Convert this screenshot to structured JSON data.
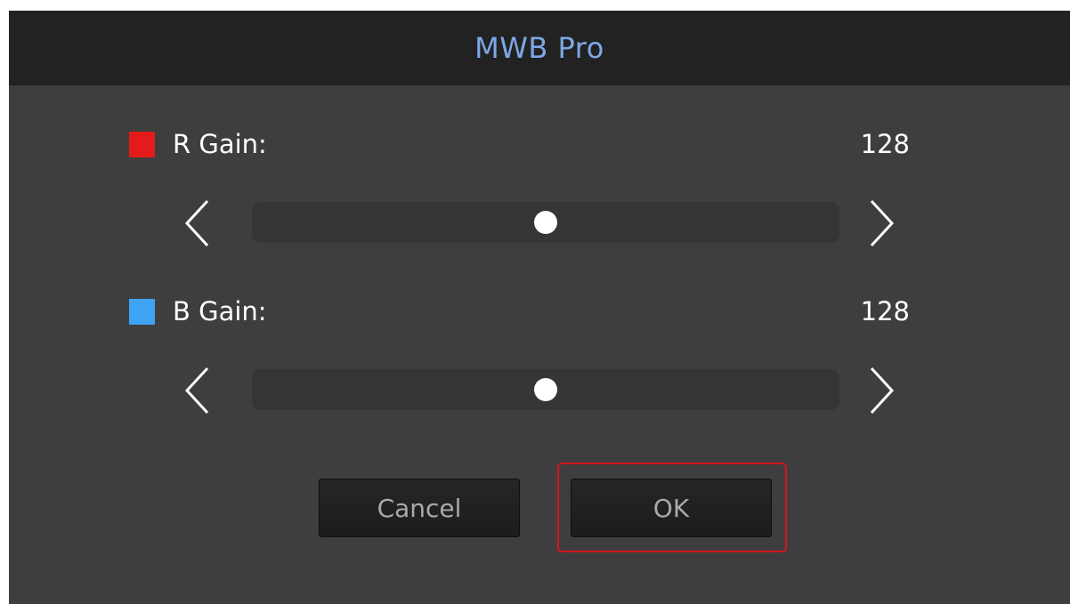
{
  "dialog": {
    "title": "MWB Pro"
  },
  "r_gain": {
    "label": "R Gain:",
    "value": "128",
    "swatch_color": "#e31b1b",
    "slider_level": 0.5
  },
  "b_gain": {
    "label": "B Gain:",
    "value": "128",
    "swatch_color": "#3fa3f3",
    "slider_level": 0.5
  },
  "buttons": {
    "cancel_label": "Cancel",
    "ok_label": "OK"
  },
  "colors": {
    "title_text": "#7ea7e6",
    "focus_ring": "#d4141a",
    "dialog_bg": "#3e3e3e",
    "titlebar_bg": "#222222"
  },
  "icons": {
    "decrement": "chevron-left-icon",
    "increment": "chevron-right-icon"
  }
}
